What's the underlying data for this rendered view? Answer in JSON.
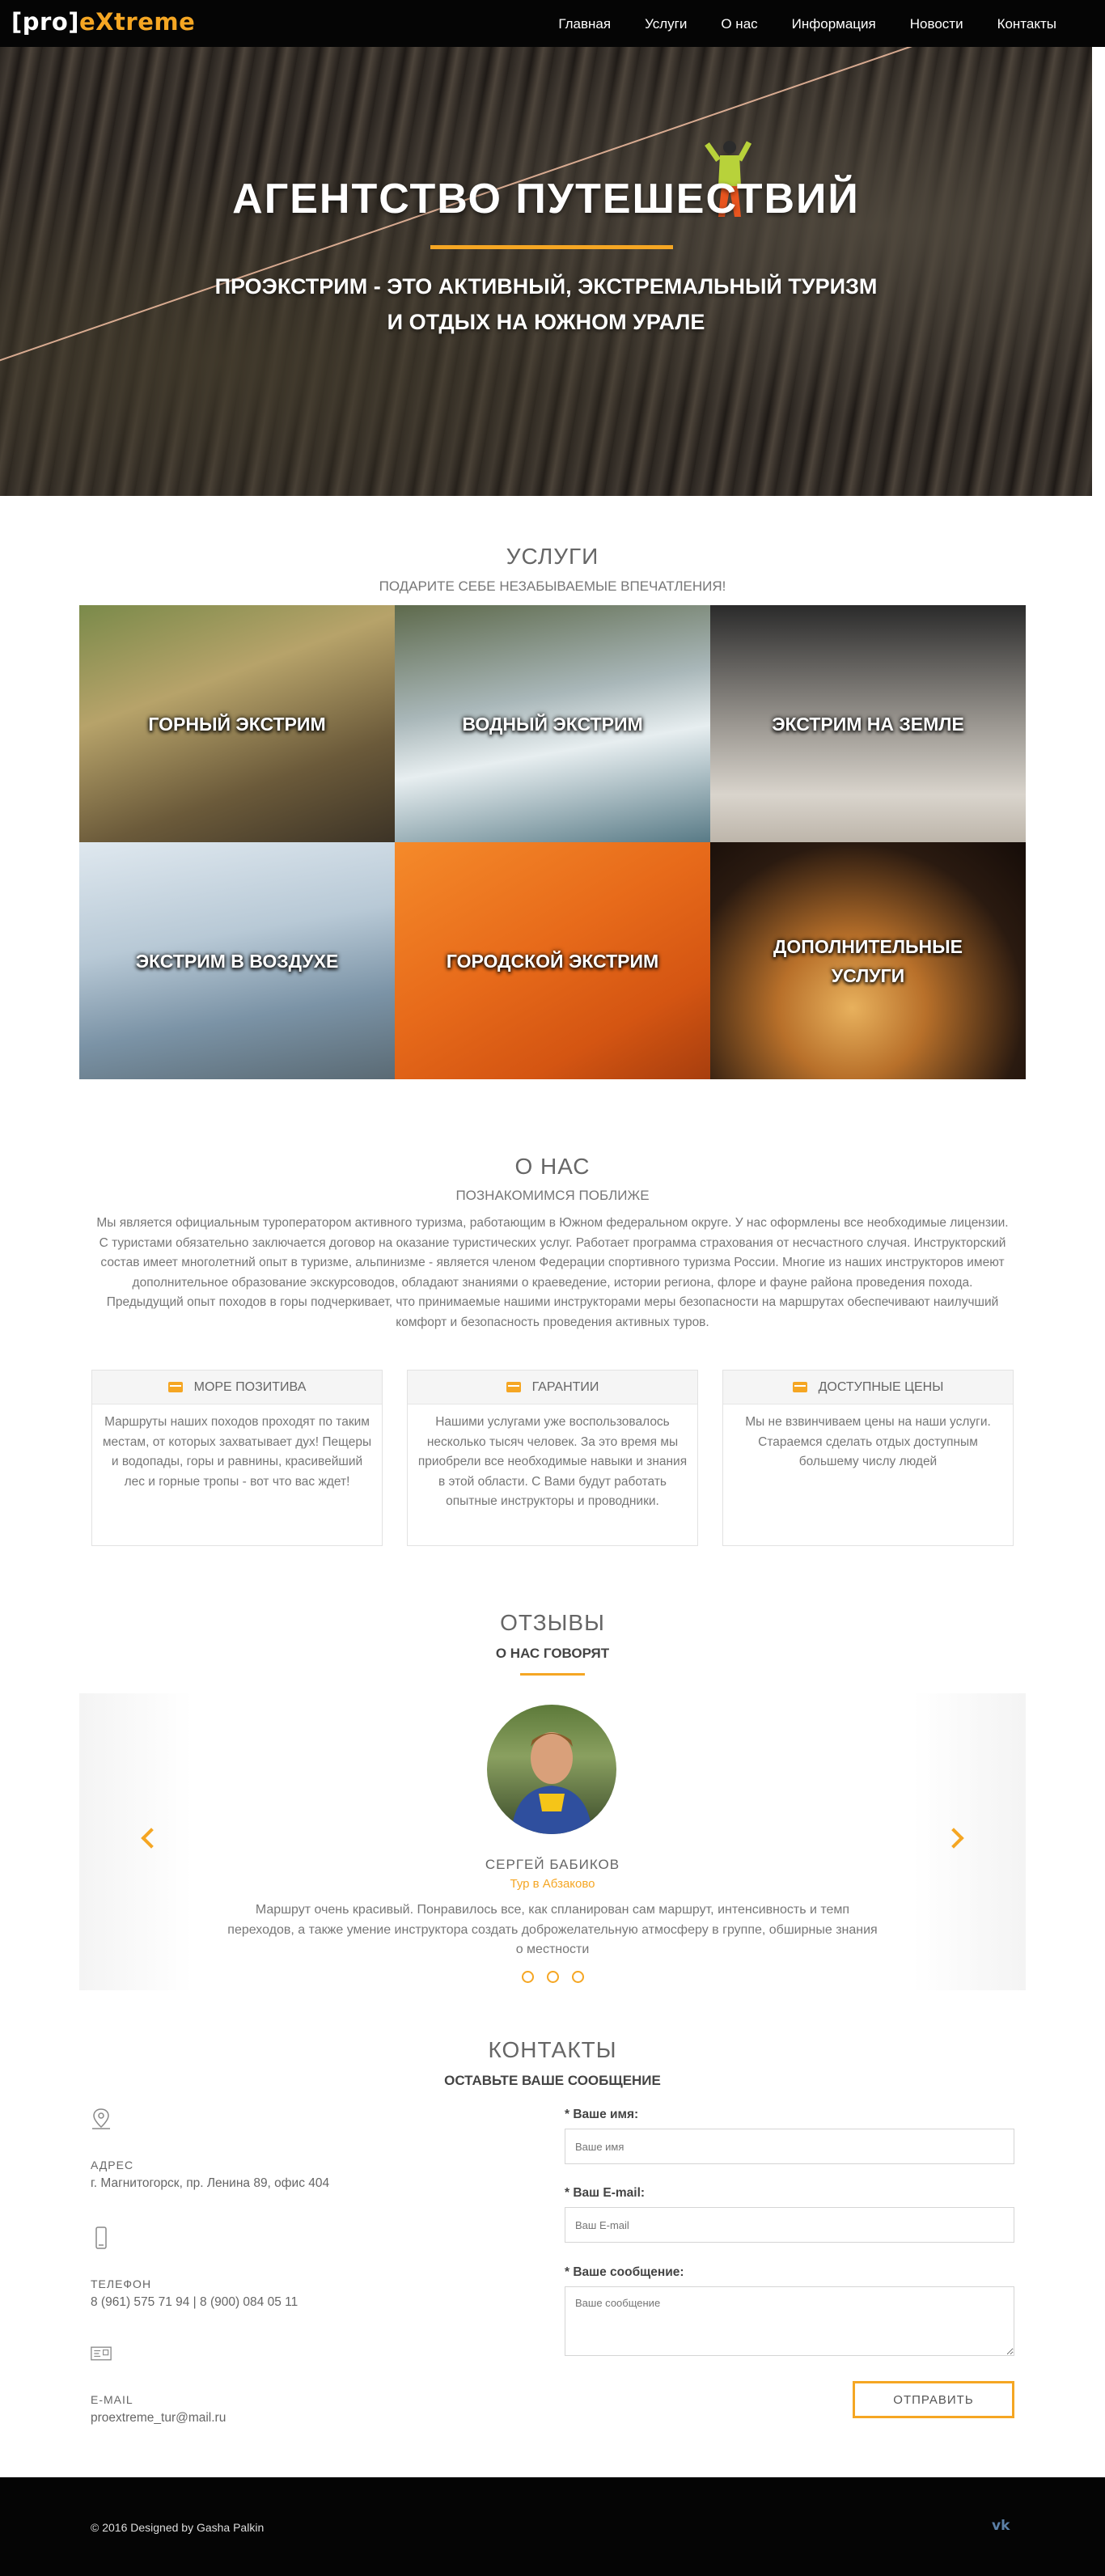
{
  "nav": {
    "logo_bracket": "[pro]",
    "logo_word": "eXtreme",
    "items": [
      "Главная",
      "Услуги",
      "О нас",
      "Информация",
      "Новости",
      "Контакты"
    ]
  },
  "hero": {
    "title": "АГЕНТСТВО ПУТЕШЕСТВИЙ",
    "subtitle_line1": "ПРОЭКСТРИМ - ЭТО АКТИВНЫЙ, ЭКСТРЕМАЛЬНЫЙ ТУРИЗМ",
    "subtitle_line2": "И ОТДЫХ НА ЮЖНОМ УРАЛЕ"
  },
  "services": {
    "title": "УСЛУГИ",
    "subtitle": "ПОДАРИТЕ СЕБЕ НЕЗАБЫВАЕМЫЕ ВПЕЧАТЛЕНИЯ!",
    "tiles": [
      "ГОРНЫЙ ЭКСТРИМ",
      "ВОДНЫЙ ЭКСТРИМ",
      "ЭКСТРИМ НА ЗЕМЛЕ",
      "ЭКСТРИМ В ВОЗДУХЕ",
      "ГОРОДСКОЙ ЭКСТРИМ",
      "ДОПОЛНИТЕЛЬНЫЕ УСЛУГИ"
    ]
  },
  "about": {
    "title": "О НАС",
    "subtitle": "ПОЗНАКОМИМСЯ ПОБЛИЖЕ",
    "text": "Мы является официальным туроператором активного туризма, работающим в Южном федеральном округе. У нас оформлены все необходимые лицензии. С туристами обязательно заключается договор на оказание туристических услуг. Работает программа страхования от несчастного случая. Инструкторский состав имеет многолетний опыт в туризме, альпинизме - является членом Федерации спортивного туризма России. Многие из наших инструкторов имеют дополнительное образование экскурсоводов, обладают знаниями о краеведение, истории региона, флоре и фауне района проведения похода. Предыдущий опыт походов в горы подчеркивает, что принимаемые нашими инструкторами меры безопасности на маршрутах обеспечивают наилучший комфорт и безопасность проведения активных туров.",
    "boxes": [
      {
        "title": "МОРЕ ПОЗИТИВА",
        "text": "Маршруты наших походов проходят по таким местам, от которых захватывает дух! Пещеры и водопады, горы и равнины, красивейший лес и горные тропы - вот что вас ждет!"
      },
      {
        "title": "ГАРАНТИИ",
        "text": "Нашими услугами уже воспользовалось несколько тысяч человек. За это время мы приобрели все необходимые навыки и знания в этой области. С Вами будут работать опытные инструкторы и проводники."
      },
      {
        "title": "ДОСТУПНЫЕ ЦЕНЫ",
        "text": "Мы не взвинчиваем цены на наши услуги. Стараемся сделать отдых доступным большему числу людей"
      }
    ]
  },
  "reviews": {
    "title": "ОТЗЫВЫ",
    "subtitle": "О НАС ГОВОРЯТ",
    "name": "СЕРГЕЙ БАБИКОВ",
    "role": "Тур в Абзаково",
    "text": "Маршрут очень красивый. Понравилось все, как спланирован сам маршрут, интенсивность и темп переходов, а также умение инструктора создать доброжелательную атмосферу в группе, обширные знания о местности",
    "dots": 3,
    "accent": "#f5a623"
  },
  "contacts": {
    "title": "КОНТАКТЫ",
    "subtitle": "ОСТАВЬТЕ ВАШЕ СООБЩЕНИЕ",
    "address_label": "АДРЕС",
    "address": "г. Магнитогорск, пр. Ленина 89, офис 404",
    "phone_label": "ТЕЛЕФОН",
    "phone": "8 (961) 575 71 94 | 8 (900) 084 05 11",
    "email_label": "E-MAIL",
    "email": "proextreme_tur@mail.ru",
    "form": {
      "name_label": "Ваше имя:",
      "name_placeholder": "Ваше имя",
      "email_label": "Ваш E-mail:",
      "email_placeholder": "Ваш E-mail",
      "message_label": "Ваше сообщение:",
      "message_placeholder": "Ваше сообщение",
      "required_mark": "*",
      "submit": "ОТПРАВИТЬ"
    }
  },
  "footer": {
    "copyright": "© 2016 Designed by Gasha Palkin",
    "social": "vk"
  }
}
